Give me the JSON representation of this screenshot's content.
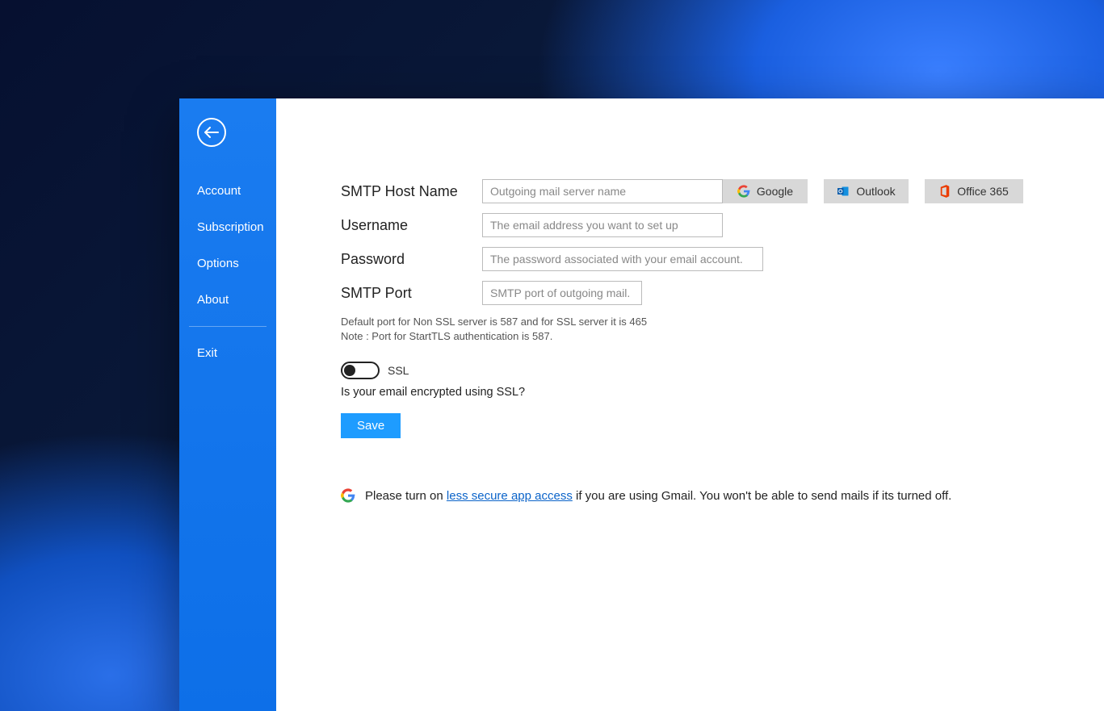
{
  "sidebar": {
    "items": [
      {
        "label": "Account"
      },
      {
        "label": "Subscription"
      },
      {
        "label": "Options"
      },
      {
        "label": "About"
      },
      {
        "label": "Exit"
      }
    ]
  },
  "form": {
    "host_label": "SMTP Host Name",
    "host_placeholder": "Outgoing mail server name",
    "user_label": "Username",
    "user_placeholder": "The email address you want to set up",
    "pass_label": "Password",
    "pass_placeholder": "The password associated with your email account.",
    "port_label": "SMTP Port",
    "port_placeholder": "SMTP port of outgoing mail.",
    "helper_line1": "Default port for Non SSL server is 587 and for SSL server it is 465",
    "helper_line2": "Note : Port for StartTLS authentication is 587.",
    "ssl_toggle_label": "SSL",
    "ssl_question": "Is your email encrypted using SSL?",
    "save_label": "Save"
  },
  "providers": {
    "google": "Google",
    "outlook": "Outlook",
    "office365": "Office 365"
  },
  "notice": {
    "prefix": "Please turn on ",
    "link_text": "less secure app access",
    "suffix": " if you are using Gmail. You won't be able to send mails if its turned off."
  }
}
